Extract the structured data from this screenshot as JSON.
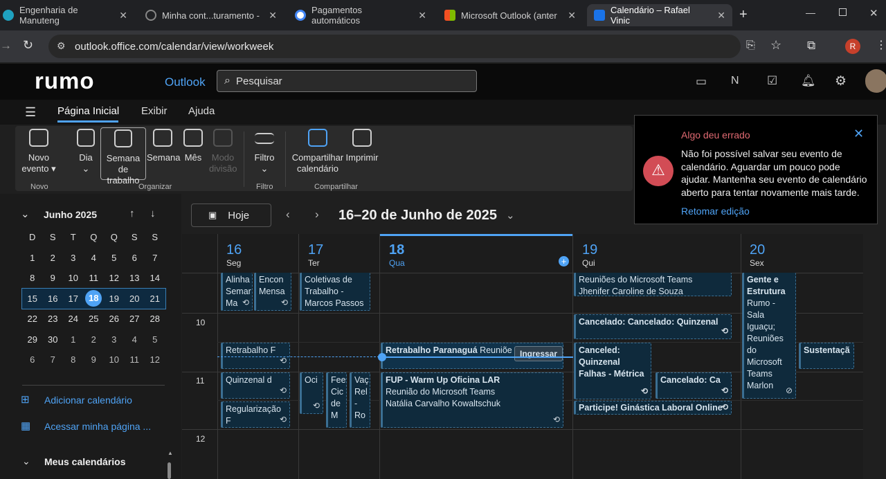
{
  "browser": {
    "tabs": [
      {
        "title": "Engenharia de Manuteng",
        "color": "#1fa2c0"
      },
      {
        "title": "Minha cont...turamento -",
        "color": "#888888"
      },
      {
        "title": "Pagamentos automáticos",
        "color": "#4285f4"
      },
      {
        "title": "Microsoft Outlook (anter",
        "color": "#f25022"
      },
      {
        "title": "Calendário – Rafael Vinic",
        "color": "#1a73e8"
      }
    ],
    "url": "outlook.office.com/calendar/view/workweek",
    "profile": "R"
  },
  "header": {
    "logo": "rumo",
    "app": "Outlook",
    "search_placeholder": "Pesquisar"
  },
  "ribbon_tabs": [
    "Página Inicial",
    "Exibir",
    "Ajuda"
  ],
  "ribbon": {
    "new_event": "Novo evento",
    "day": "Dia",
    "work_week": "Semana de trabalho",
    "week": "Semana",
    "month": "Mês",
    "split": "Modo divisão",
    "filter": "Filtro",
    "share": "Compartilhar calendário",
    "print": "Imprimir",
    "groups": [
      "Novo",
      "Organizar",
      "Filtro",
      "Compartilhar"
    ]
  },
  "error": {
    "title": "Algo deu errado",
    "body": "Não foi possível salvar seu evento de calendário. Aguardar um pouco pode ajudar. Mantenha seu evento de calendário aberto para tentar novamente mais tarde.",
    "link": "Retomar edição"
  },
  "mini_cal": {
    "title": "Junho 2025",
    "weekdays": [
      "D",
      "S",
      "T",
      "Q",
      "Q",
      "S",
      "S"
    ],
    "weeks": [
      [
        "1",
        "2",
        "3",
        "4",
        "5",
        "6",
        "7"
      ],
      [
        "8",
        "9",
        "10",
        "11",
        "12",
        "13",
        "14"
      ],
      [
        "15",
        "16",
        "17",
        "18",
        "19",
        "20",
        "21"
      ],
      [
        "22",
        "23",
        "24",
        "25",
        "26",
        "27",
        "28"
      ],
      [
        "29",
        "30",
        "1",
        "2",
        "3",
        "4",
        "5"
      ],
      [
        "6",
        "7",
        "8",
        "9",
        "10",
        "11",
        "12"
      ]
    ],
    "today": "18"
  },
  "nav": {
    "add_calendar": "Adicionar calendário",
    "my_page": "Acessar minha página ...",
    "my_calendars": "Meus calendários"
  },
  "toolbar": {
    "today": "Hoje",
    "range": "16–20 de Junho de 2025"
  },
  "days": [
    {
      "num": "16",
      "name": "Seg"
    },
    {
      "num": "17",
      "name": "Ter"
    },
    {
      "num": "18",
      "name": "Qua"
    },
    {
      "num": "19",
      "name": "Qui"
    },
    {
      "num": "20",
      "name": "Sex"
    }
  ],
  "hours": [
    "10",
    "11",
    "12"
  ],
  "events": {
    "e1": "Alinha Semar Ma",
    "e2": "Encon Mensa",
    "e3": "Coletivas de Trabalho - Marcos Passos",
    "e4": "Reuniões do Microsoft Teams",
    "e4b": "Jhenifer Caroline de Souza",
    "e5": "Gente e Estrutura",
    "e5b": "Rumo - Sala Iguaçu; Reuniões do Microsoft Teams Marlon",
    "e6": "Cancelado: Cancelado: Quinzenal",
    "e7": "Retrabalho F",
    "e8a": "Retrabalho Paranaguá",
    "e8b": "Reuniõe",
    "e8c": "Ingressar",
    "e9": "Canceled: Quinzenal Falhas - Métrica",
    "e10": "Sustentaçã",
    "e11": "Quinzenal d",
    "e12": "Oci",
    "e13": "Fee Cic de M",
    "e14": "Vaç Rel - Ro",
    "e15a": "FUP - Warm Up Oficina LAR",
    "e15b": "Reunião do Microsoft Teams",
    "e15c": "Natália Carvalho Kowaltschuk",
    "e16": "Cancelado: Ca",
    "e17": "Regularização F",
    "e18": "Participe! Ginástica Laboral Online"
  }
}
